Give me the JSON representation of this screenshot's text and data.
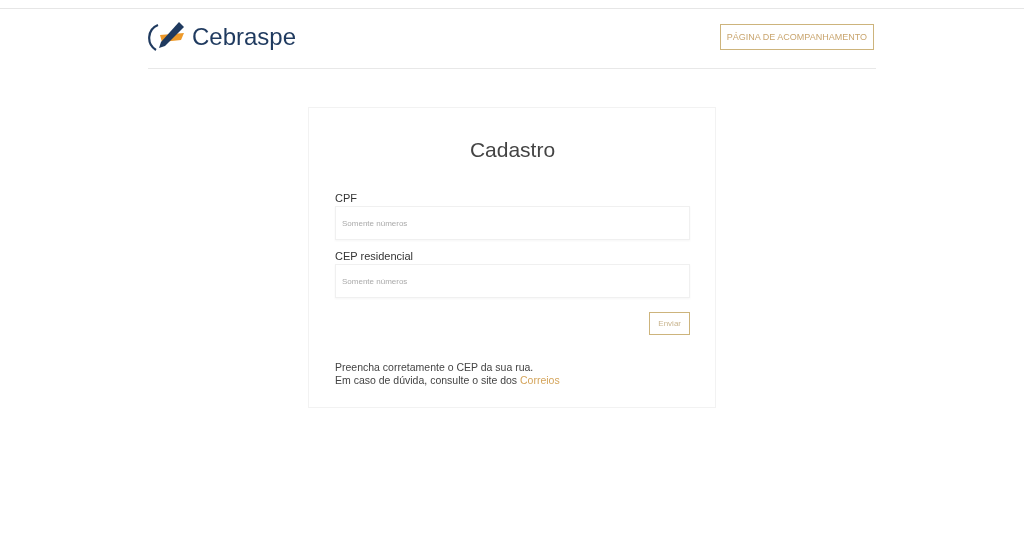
{
  "header": {
    "brand": "Cebraspe",
    "link_button": "PÁGINA DE ACOMPANHAMENTO"
  },
  "form": {
    "title": "Cadastro",
    "fields": [
      {
        "label": "CPF",
        "placeholder": "Somente números"
      },
      {
        "label": "CEP residencial",
        "placeholder": "Somente números"
      }
    ],
    "submit": "Enviar",
    "note": "Preencha corretamente o CEP da sua rua.",
    "help": {
      "text": "Em caso de dúvida, consulte o site dos",
      "link": "Correios"
    }
  }
}
